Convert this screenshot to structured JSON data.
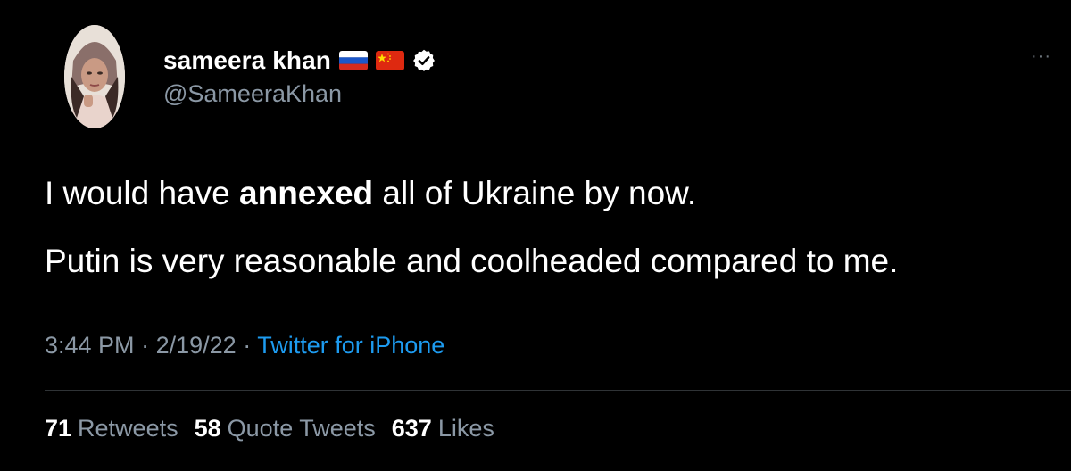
{
  "author": {
    "display_name": "sameera khan",
    "handle": "@SameeraKhan",
    "flags": [
      "russia-flag",
      "china-flag"
    ],
    "verified": true
  },
  "tweet": {
    "line1_pre": "I would have ",
    "line1_bold": "annexed",
    "line1_post": " all of Ukraine by now.",
    "line2": "Putin is very reasonable and coolheaded compared to me."
  },
  "meta": {
    "time": "3:44 PM",
    "separator": "·",
    "date": "2/19/22",
    "source": "Twitter for iPhone"
  },
  "stats": {
    "retweets_count": "71",
    "retweets_label": "Retweets",
    "quote_count": "58",
    "quote_label": "Quote Tweets",
    "likes_count": "637",
    "likes_label": "Likes"
  },
  "more_menu": "···",
  "colors": {
    "background": "#000000",
    "text": "#ffffff",
    "secondary": "#8b98a5",
    "link": "#1d9bf0",
    "verified": "#ffffff"
  }
}
